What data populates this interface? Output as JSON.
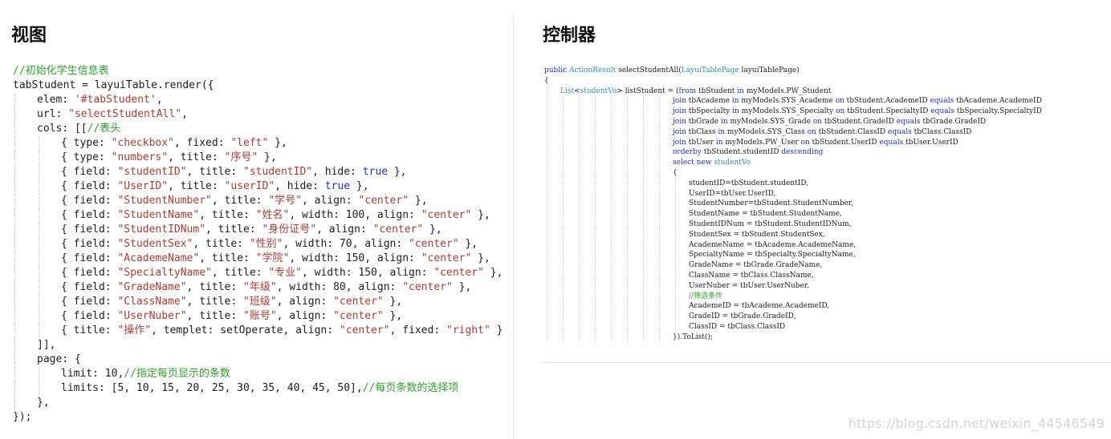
{
  "left_panel": {
    "title": "视图",
    "lines": [
      {
        "indent": 0,
        "tokens": [
          {
            "t": "c",
            "v": "//初始化学生信息表"
          }
        ]
      },
      {
        "indent": 0,
        "tokens": [
          {
            "t": "p",
            "v": "tabStudent = layuiTable.render({"
          }
        ]
      },
      {
        "indent": 1,
        "tokens": [
          {
            "t": "p",
            "v": "elem: "
          },
          {
            "t": "s",
            "v": "'#tabStudent'"
          },
          {
            "t": "p",
            "v": ","
          }
        ]
      },
      {
        "indent": 1,
        "tokens": [
          {
            "t": "p",
            "v": "url: "
          },
          {
            "t": "s",
            "v": "\"selectStudentAll\""
          },
          {
            "t": "p",
            "v": ","
          }
        ]
      },
      {
        "indent": 1,
        "tokens": [
          {
            "t": "p",
            "v": "cols: [["
          },
          {
            "t": "c",
            "v": "//表头"
          }
        ]
      },
      {
        "indent": 2,
        "tokens": [
          {
            "t": "p",
            "v": "{ type: "
          },
          {
            "t": "s",
            "v": "\"checkbox\""
          },
          {
            "t": "p",
            "v": ", fixed: "
          },
          {
            "t": "s",
            "v": "\"left\""
          },
          {
            "t": "p",
            "v": " },"
          }
        ]
      },
      {
        "indent": 2,
        "tokens": [
          {
            "t": "p",
            "v": "{ type: "
          },
          {
            "t": "s",
            "v": "\"numbers\""
          },
          {
            "t": "p",
            "v": ", title: "
          },
          {
            "t": "s",
            "v": "\"序号\""
          },
          {
            "t": "p",
            "v": " },"
          }
        ]
      },
      {
        "indent": 2,
        "tokens": [
          {
            "t": "p",
            "v": "{ field: "
          },
          {
            "t": "s",
            "v": "\"studentID\""
          },
          {
            "t": "p",
            "v": ", title: "
          },
          {
            "t": "s",
            "v": "\"studentID\""
          },
          {
            "t": "p",
            "v": ", hide: "
          },
          {
            "t": "k",
            "v": "true"
          },
          {
            "t": "p",
            "v": " },"
          }
        ]
      },
      {
        "indent": 2,
        "tokens": [
          {
            "t": "p",
            "v": "{ field: "
          },
          {
            "t": "s",
            "v": "\"UserID\""
          },
          {
            "t": "p",
            "v": ", title: "
          },
          {
            "t": "s",
            "v": "\"userID\""
          },
          {
            "t": "p",
            "v": ", hide: "
          },
          {
            "t": "k",
            "v": "true"
          },
          {
            "t": "p",
            "v": " },"
          }
        ]
      },
      {
        "indent": 2,
        "tokens": [
          {
            "t": "p",
            "v": "{ field: "
          },
          {
            "t": "s",
            "v": "\"StudentNumber\""
          },
          {
            "t": "p",
            "v": ", title: "
          },
          {
            "t": "s",
            "v": "\"学号\""
          },
          {
            "t": "p",
            "v": ", align: "
          },
          {
            "t": "s",
            "v": "\"center\""
          },
          {
            "t": "p",
            "v": " },"
          }
        ]
      },
      {
        "indent": 2,
        "tokens": [
          {
            "t": "p",
            "v": "{ field: "
          },
          {
            "t": "s",
            "v": "\"StudentName\""
          },
          {
            "t": "p",
            "v": ", title: "
          },
          {
            "t": "s",
            "v": "\"姓名\""
          },
          {
            "t": "p",
            "v": ", width: 100, align: "
          },
          {
            "t": "s",
            "v": "\"center\""
          },
          {
            "t": "p",
            "v": " },"
          }
        ]
      },
      {
        "indent": 2,
        "tokens": [
          {
            "t": "p",
            "v": "{ field: "
          },
          {
            "t": "s",
            "v": "\"StudentIDNum\""
          },
          {
            "t": "p",
            "v": ", title: "
          },
          {
            "t": "s",
            "v": "\"身份证号\""
          },
          {
            "t": "p",
            "v": ", align: "
          },
          {
            "t": "s",
            "v": "\"center\""
          },
          {
            "t": "p",
            "v": " },"
          }
        ]
      },
      {
        "indent": 2,
        "tokens": [
          {
            "t": "p",
            "v": "{ field: "
          },
          {
            "t": "s",
            "v": "\"StudentSex\""
          },
          {
            "t": "p",
            "v": ", title: "
          },
          {
            "t": "s",
            "v": "\"性别\""
          },
          {
            "t": "p",
            "v": ", width: 70, align: "
          },
          {
            "t": "s",
            "v": "\"center\""
          },
          {
            "t": "p",
            "v": " },"
          }
        ]
      },
      {
        "indent": 2,
        "tokens": [
          {
            "t": "p",
            "v": "{ field: "
          },
          {
            "t": "s",
            "v": "\"AcademeName\""
          },
          {
            "t": "p",
            "v": ", title: "
          },
          {
            "t": "s",
            "v": "\"学院\""
          },
          {
            "t": "p",
            "v": ", width: 150, align: "
          },
          {
            "t": "s",
            "v": "\"center\""
          },
          {
            "t": "p",
            "v": " },"
          }
        ]
      },
      {
        "indent": 2,
        "tokens": [
          {
            "t": "p",
            "v": "{ field: "
          },
          {
            "t": "s",
            "v": "\"SpecialtyName\""
          },
          {
            "t": "p",
            "v": ", title: "
          },
          {
            "t": "s",
            "v": "\"专业\""
          },
          {
            "t": "p",
            "v": ", width: 150, align: "
          },
          {
            "t": "s",
            "v": "\"center\""
          },
          {
            "t": "p",
            "v": " },"
          }
        ]
      },
      {
        "indent": 2,
        "tokens": [
          {
            "t": "p",
            "v": "{ field: "
          },
          {
            "t": "s",
            "v": "\"GradeName\""
          },
          {
            "t": "p",
            "v": ", title: "
          },
          {
            "t": "s",
            "v": "\"年级\""
          },
          {
            "t": "p",
            "v": ", width: 80, align: "
          },
          {
            "t": "s",
            "v": "\"center\""
          },
          {
            "t": "p",
            "v": " },"
          }
        ]
      },
      {
        "indent": 2,
        "tokens": [
          {
            "t": "p",
            "v": "{ field: "
          },
          {
            "t": "s",
            "v": "\"ClassName\""
          },
          {
            "t": "p",
            "v": ", title: "
          },
          {
            "t": "s",
            "v": "\"班级\""
          },
          {
            "t": "p",
            "v": ", align: "
          },
          {
            "t": "s",
            "v": "\"center\""
          },
          {
            "t": "p",
            "v": " },"
          }
        ]
      },
      {
        "indent": 2,
        "tokens": [
          {
            "t": "p",
            "v": "{ field: "
          },
          {
            "t": "s",
            "v": "\"UserNuber\""
          },
          {
            "t": "p",
            "v": ", title: "
          },
          {
            "t": "s",
            "v": "\"账号\""
          },
          {
            "t": "p",
            "v": ", align: "
          },
          {
            "t": "s",
            "v": "\"center\""
          },
          {
            "t": "p",
            "v": " },"
          }
        ]
      },
      {
        "indent": 2,
        "tokens": [
          {
            "t": "p",
            "v": "{ title: "
          },
          {
            "t": "s",
            "v": "\"操作\""
          },
          {
            "t": "p",
            "v": ", templet: setOperate, align: "
          },
          {
            "t": "s",
            "v": "\"center\""
          },
          {
            "t": "p",
            "v": ", fixed: "
          },
          {
            "t": "s",
            "v": "\"right\""
          },
          {
            "t": "p",
            "v": " }"
          }
        ]
      },
      {
        "indent": 1,
        "tokens": [
          {
            "t": "p",
            "v": "]],"
          }
        ]
      },
      {
        "indent": 1,
        "tokens": [
          {
            "t": "p",
            "v": "page: {"
          }
        ]
      },
      {
        "indent": 2,
        "tokens": [
          {
            "t": "p",
            "v": "limit: 10,"
          },
          {
            "t": "c",
            "v": "//指定每页显示的条数"
          }
        ]
      },
      {
        "indent": 2,
        "tokens": [
          {
            "t": "p",
            "v": "limits: [5, 10, 15, 20, 25, 30, 35, 40, 45, 50],"
          },
          {
            "t": "c",
            "v": "//每页条数的选择项"
          }
        ]
      },
      {
        "indent": 1,
        "tokens": [
          {
            "t": "p",
            "v": "},"
          }
        ]
      },
      {
        "indent": 0,
        "tokens": [
          {
            "t": "p",
            "v": "});"
          }
        ]
      }
    ]
  },
  "right_panel": {
    "title": "控制器",
    "lines": [
      {
        "indent": 0,
        "tokens": [
          {
            "t": "k",
            "v": "public "
          },
          {
            "t": "y",
            "v": "ActionResult"
          },
          {
            "t": "p",
            "v": " selectStudentAll("
          },
          {
            "t": "y",
            "v": "LayuiTablePage"
          },
          {
            "t": "p",
            "v": " layuiTablePage)"
          }
        ]
      },
      {
        "indent": 0,
        "tokens": [
          {
            "t": "p",
            "v": "{"
          }
        ]
      },
      {
        "indent": 1,
        "tokens": [
          {
            "t": "y",
            "v": "List"
          },
          {
            "t": "p",
            "v": "<"
          },
          {
            "t": "y",
            "v": "studentVo"
          },
          {
            "t": "p",
            "v": "> listStudent = ("
          },
          {
            "t": "k",
            "v": "from"
          },
          {
            "t": "p",
            "v": " tbStudent "
          },
          {
            "t": "k",
            "v": "in"
          },
          {
            "t": "p",
            "v": " myModels.PW_Student"
          }
        ]
      },
      {
        "indent": 8,
        "tokens": [
          {
            "t": "k",
            "v": "join"
          },
          {
            "t": "p",
            "v": " tbAcademe "
          },
          {
            "t": "k",
            "v": "in"
          },
          {
            "t": "p",
            "v": " myModels.SYS_Academe "
          },
          {
            "t": "k",
            "v": "on"
          },
          {
            "t": "p",
            "v": " tbStudent.AcademeID "
          },
          {
            "t": "k",
            "v": "equals"
          },
          {
            "t": "p",
            "v": " tbAcademe.AcademeID"
          }
        ]
      },
      {
        "indent": 8,
        "tokens": [
          {
            "t": "k",
            "v": "join"
          },
          {
            "t": "p",
            "v": " tbSpecialty "
          },
          {
            "t": "k",
            "v": "in"
          },
          {
            "t": "p",
            "v": " myModels.SYS_Specialty "
          },
          {
            "t": "k",
            "v": "on"
          },
          {
            "t": "p",
            "v": " tbStudent.SpecialtyID "
          },
          {
            "t": "k",
            "v": "equals"
          },
          {
            "t": "p",
            "v": " tbSpecialty.SpecialtyID"
          }
        ]
      },
      {
        "indent": 8,
        "tokens": [
          {
            "t": "k",
            "v": "join"
          },
          {
            "t": "p",
            "v": " tbGrade "
          },
          {
            "t": "k",
            "v": "in"
          },
          {
            "t": "p",
            "v": " myModels.SYS_Grade "
          },
          {
            "t": "k",
            "v": "on"
          },
          {
            "t": "p",
            "v": " tbStudent.GradeID "
          },
          {
            "t": "k",
            "v": "equals"
          },
          {
            "t": "p",
            "v": " tbGrade.GradeID"
          }
        ]
      },
      {
        "indent": 8,
        "tokens": [
          {
            "t": "k",
            "v": "join"
          },
          {
            "t": "p",
            "v": " tbClass "
          },
          {
            "t": "k",
            "v": "in"
          },
          {
            "t": "p",
            "v": " myModels.SYS_Class "
          },
          {
            "t": "k",
            "v": "on"
          },
          {
            "t": "p",
            "v": " tbStudent.ClassID "
          },
          {
            "t": "k",
            "v": "equals"
          },
          {
            "t": "p",
            "v": " tbClass.ClassID"
          }
        ]
      },
      {
        "indent": 8,
        "tokens": [
          {
            "t": "k",
            "v": "join"
          },
          {
            "t": "p",
            "v": " tbUser "
          },
          {
            "t": "k",
            "v": "in"
          },
          {
            "t": "p",
            "v": " myModels.PW_User "
          },
          {
            "t": "k",
            "v": "on"
          },
          {
            "t": "p",
            "v": " tbStudent.UserID "
          },
          {
            "t": "k",
            "v": "equals"
          },
          {
            "t": "p",
            "v": " tbUser.UserID"
          }
        ]
      },
      {
        "indent": 8,
        "tokens": [
          {
            "t": "k",
            "v": "orderby"
          },
          {
            "t": "p",
            "v": " tbStudent.studentID "
          },
          {
            "t": "k",
            "v": "descending"
          }
        ]
      },
      {
        "indent": 8,
        "tokens": [
          {
            "t": "k",
            "v": "select new "
          },
          {
            "t": "y",
            "v": "studentVo"
          }
        ]
      },
      {
        "indent": 8,
        "tokens": [
          {
            "t": "p",
            "v": "{"
          }
        ]
      },
      {
        "indent": 9,
        "tokens": [
          {
            "t": "p",
            "v": "studentID=tbStudent.studentID,"
          }
        ]
      },
      {
        "indent": 9,
        "tokens": [
          {
            "t": "p",
            "v": "UserID=tbUser.UserID,"
          }
        ]
      },
      {
        "indent": 9,
        "tokens": [
          {
            "t": "p",
            "v": "StudentNumber=tbStudent.StudentNumber,"
          }
        ]
      },
      {
        "indent": 9,
        "tokens": [
          {
            "t": "p",
            "v": "StudentName = tbStudent.StudentName,"
          }
        ]
      },
      {
        "indent": 9,
        "tokens": [
          {
            "t": "p",
            "v": "StudentIDNum = tbStudent.StudentIDNum,"
          }
        ]
      },
      {
        "indent": 9,
        "tokens": [
          {
            "t": "p",
            "v": "StudentSex = tbStudent.StudentSex,"
          }
        ]
      },
      {
        "indent": 9,
        "tokens": [
          {
            "t": "p",
            "v": "AcademeName = tbAcademe.AcademeName,"
          }
        ]
      },
      {
        "indent": 9,
        "tokens": [
          {
            "t": "p",
            "v": "SpecialtyName = tbSpecialty.SpecialtyName,"
          }
        ]
      },
      {
        "indent": 9,
        "tokens": [
          {
            "t": "p",
            "v": "GradeName = tbGrade.GradeName,"
          }
        ]
      },
      {
        "indent": 9,
        "tokens": [
          {
            "t": "p",
            "v": "ClassName = tbClass.ClassName,"
          }
        ]
      },
      {
        "indent": 9,
        "tokens": [
          {
            "t": "p",
            "v": "UserNuber = tbUser.UserNuber,"
          }
        ]
      },
      {
        "indent": 9,
        "tokens": [
          {
            "t": "c",
            "v": "//筛选条件"
          }
        ]
      },
      {
        "indent": 9,
        "tokens": [
          {
            "t": "p",
            "v": "AcademeID = tbAcademe.AcademeID,"
          }
        ]
      },
      {
        "indent": 9,
        "tokens": [
          {
            "t": "p",
            "v": "GradeID = tbGrade.GradeID,"
          }
        ]
      },
      {
        "indent": 9,
        "tokens": [
          {
            "t": "p",
            "v": "ClassID = tbClass.ClassID"
          }
        ]
      },
      {
        "indent": 8,
        "tokens": [
          {
            "t": "p",
            "v": "}).ToList();"
          }
        ]
      }
    ]
  },
  "watermark": "https://blog.csdn.net/weixin_44546549"
}
